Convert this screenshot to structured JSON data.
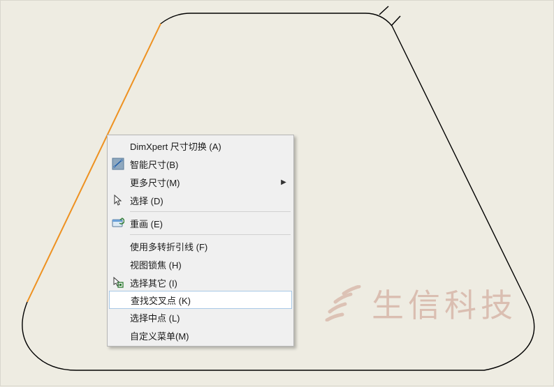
{
  "watermark": {
    "text": "生信科技",
    "icon_name": "sunrise-rays-icon",
    "color": "#b05a43"
  },
  "context_menu": {
    "items": [
      {
        "label": "DimXpert 尺寸切换 (A)",
        "icon": null,
        "submenu": false,
        "highlight": false
      },
      {
        "label": "智能尺寸(B)",
        "icon": "dimension-icon",
        "submenu": false,
        "highlight": false
      },
      {
        "label": "更多尺寸(M)",
        "icon": null,
        "submenu": true,
        "highlight": false
      },
      {
        "label": "选择 (D)",
        "icon": "cursor-icon",
        "submenu": false,
        "highlight": false
      },
      {
        "sep": true
      },
      {
        "label": "重画 (E)",
        "icon": "redraw-icon",
        "submenu": false,
        "highlight": false
      },
      {
        "sep": true
      },
      {
        "label": "使用多转折引线 (F)",
        "icon": null,
        "submenu": false,
        "highlight": false
      },
      {
        "label": "视图锁焦 (H)",
        "icon": null,
        "submenu": false,
        "highlight": false
      },
      {
        "label": "选择其它 (I)",
        "icon": "select-other-icon",
        "submenu": false,
        "highlight": false
      },
      {
        "label": "查找交叉点 (K)",
        "icon": null,
        "submenu": false,
        "highlight": true
      },
      {
        "label": "选择中点 (L)",
        "icon": null,
        "submenu": false,
        "highlight": false
      },
      {
        "label": "自定义菜单(M)",
        "icon": null,
        "submenu": false,
        "highlight": false
      }
    ]
  },
  "sketch": {
    "selected_edge_color": "#ef9221",
    "edge_color": "#000000"
  }
}
